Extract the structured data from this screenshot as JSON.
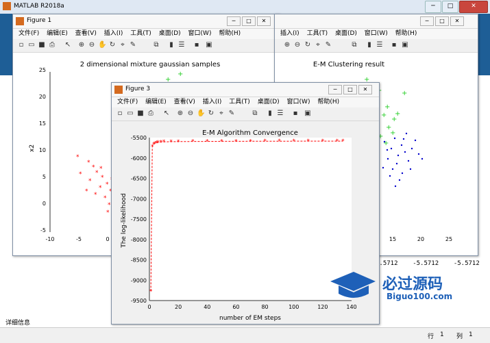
{
  "app": {
    "title": "MATLAB R2018a"
  },
  "fig1": {
    "window_title": "Figure 1",
    "menus": [
      "文件(F)",
      "编辑(E)",
      "查看(V)",
      "插入(I)",
      "工具(T)",
      "桌面(D)",
      "窗口(W)",
      "帮助(H)"
    ],
    "plot_title": "2 dimensional mixture gaussian samples",
    "ylabel": "x2",
    "yticks": [
      "25",
      "20",
      "15",
      "10",
      "5",
      "0",
      "-5"
    ],
    "xticks": [
      "-10",
      "-5",
      "0"
    ]
  },
  "fig2": {
    "menus": [
      "插入(I)",
      "工具(T)",
      "桌面(D)",
      "窗口(W)",
      "帮助(H)"
    ],
    "plot_title": "E-M Clustering result",
    "xticks": [
      "15",
      "20",
      "25"
    ]
  },
  "fig3": {
    "window_title": "Figure 3",
    "menus": [
      "文件(F)",
      "编辑(E)",
      "查看(V)",
      "插入(I)",
      "工具(T)",
      "桌面(D)",
      "窗口(W)",
      "帮助(H)"
    ],
    "chart_data": {
      "type": "line",
      "title": "E-M Algorithm Convergence",
      "xlabel": "number of EM steps",
      "ylabel": "The log-likelihood",
      "xlim": [
        0,
        140
      ],
      "ylim": [
        -9500,
        -5500
      ],
      "xticks": [
        0,
        20,
        40,
        60,
        80,
        100,
        120,
        140
      ],
      "yticks": [
        -5500,
        -6000,
        -6500,
        -7000,
        -7500,
        -8000,
        -8500,
        -9000,
        -9500
      ],
      "series": [
        {
          "color": "#ff0000",
          "x": [
            1,
            2,
            3,
            4,
            5,
            6,
            8,
            10,
            15,
            20,
            30,
            40,
            50,
            60,
            70,
            80,
            90,
            100,
            110,
            120,
            130,
            134
          ],
          "y": [
            -9270,
            -5720,
            -5660,
            -5640,
            -5630,
            -5620,
            -5610,
            -5605,
            -5600,
            -5598,
            -5595,
            -5593,
            -5591,
            -5590,
            -5589,
            -5588,
            -5588,
            -5587,
            -5587,
            -5587,
            -5587,
            -5587
          ]
        }
      ]
    }
  },
  "cmd": {
    "values": [
      "5.5712",
      "-5.5712",
      "-5.5712"
    ]
  },
  "status": {
    "detail": "详细信息",
    "row_label": "行",
    "row_value": "1",
    "col_label": "列",
    "col_value": "1"
  },
  "watermark": {
    "cn": "必过源码",
    "url": "Biguo100.com"
  }
}
